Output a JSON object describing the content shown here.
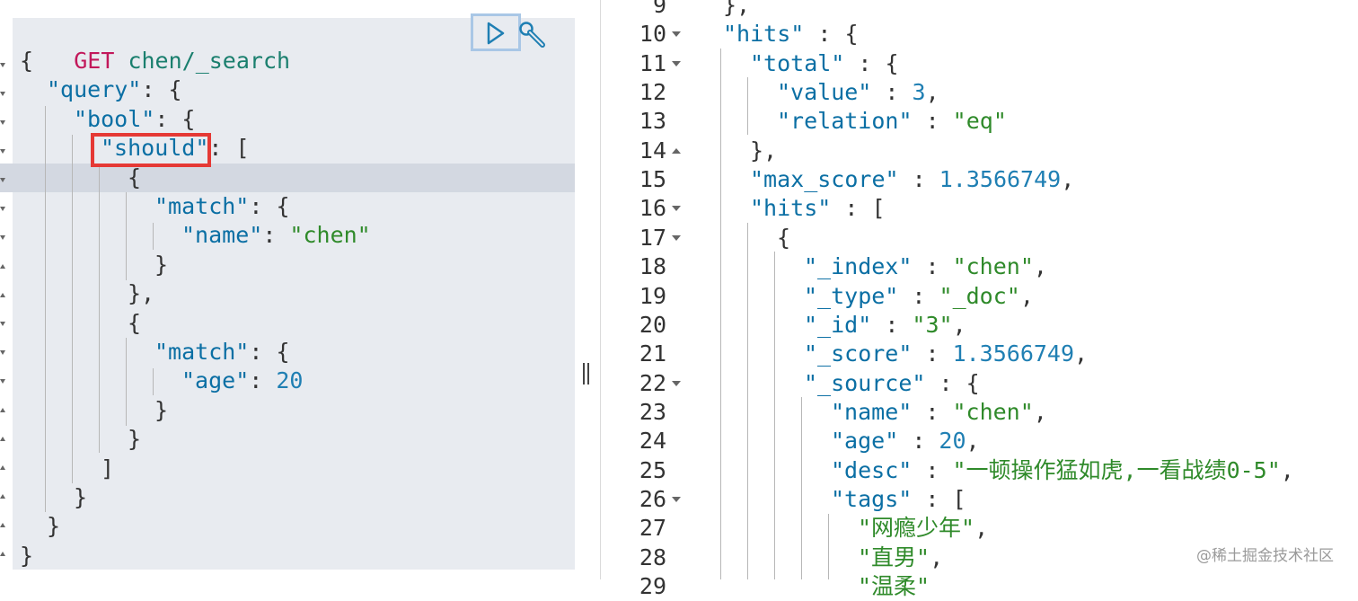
{
  "request": {
    "method": "GET",
    "path": "chen/_search",
    "lines": [
      {
        "t": "{"
      },
      {
        "k": "\"query\"",
        "t": ": {"
      },
      {
        "k": "\"bool\"",
        "t": ": {"
      },
      {
        "k": "\"should\"",
        "t": ": ["
      },
      {
        "t": "{"
      },
      {
        "k": "\"match\"",
        "t": ": {"
      },
      {
        "k": "\"name\"",
        "t": ": ",
        "s": "\"chen\""
      },
      {
        "t": "}"
      },
      {
        "t": "},"
      },
      {
        "t": "{"
      },
      {
        "k": "\"match\"",
        "t": ": {"
      },
      {
        "k": "\"age\"",
        "t": ": ",
        "n": "20"
      },
      {
        "t": "}"
      },
      {
        "t": "}"
      },
      {
        "t": "]"
      },
      {
        "t": "}"
      },
      {
        "t": "}"
      },
      {
        "t": "}"
      }
    ]
  },
  "toolbar": {
    "run_icon": "play-icon",
    "settings_icon": "wrench-icon"
  },
  "response": {
    "line_numbers": [
      "9",
      "10",
      "11",
      "12",
      "13",
      "14",
      "15",
      "16",
      "17",
      "18",
      "19",
      "20",
      "21",
      "22",
      "23",
      "24",
      "25",
      "26",
      "27",
      "28",
      "29"
    ],
    "lines": [
      {
        "t": "},"
      },
      {
        "k": "\"hits\"",
        "t": " : {"
      },
      {
        "k": "\"total\"",
        "t": " : {"
      },
      {
        "k": "\"value\"",
        "t": " : ",
        "n": "3",
        "e": ","
      },
      {
        "k": "\"relation\"",
        "t": " : ",
        "s": "\"eq\""
      },
      {
        "t": "},"
      },
      {
        "k": "\"max_score\"",
        "t": " : ",
        "n": "1.3566749",
        "e": ","
      },
      {
        "k": "\"hits\"",
        "t": " : ["
      },
      {
        "t": "{"
      },
      {
        "k": "\"_index\"",
        "t": " : ",
        "s": "\"chen\"",
        "e": ","
      },
      {
        "k": "\"_type\"",
        "t": " : ",
        "s": "\"_doc\"",
        "e": ","
      },
      {
        "k": "\"_id\"",
        "t": " : ",
        "s": "\"3\"",
        "e": ","
      },
      {
        "k": "\"_score\"",
        "t": " : ",
        "n": "1.3566749",
        "e": ","
      },
      {
        "k": "\"_source\"",
        "t": " : {"
      },
      {
        "k": "\"name\"",
        "t": " : ",
        "s": "\"chen\"",
        "e": ","
      },
      {
        "k": "\"age\"",
        "t": " : ",
        "n": "20",
        "e": ","
      },
      {
        "k": "\"desc\"",
        "t": " : ",
        "s": "\"一顿操作猛如虎,一看战绩0-5\"",
        "e": ","
      },
      {
        "k": "\"tags\"",
        "t": " : ["
      },
      {
        "s": "\"网瘾少年\"",
        "e": ","
      },
      {
        "s": "\"直男\"",
        "e": ","
      },
      {
        "s": "\"温柔\""
      }
    ]
  },
  "watermark": "@稀土掘金技术社区"
}
